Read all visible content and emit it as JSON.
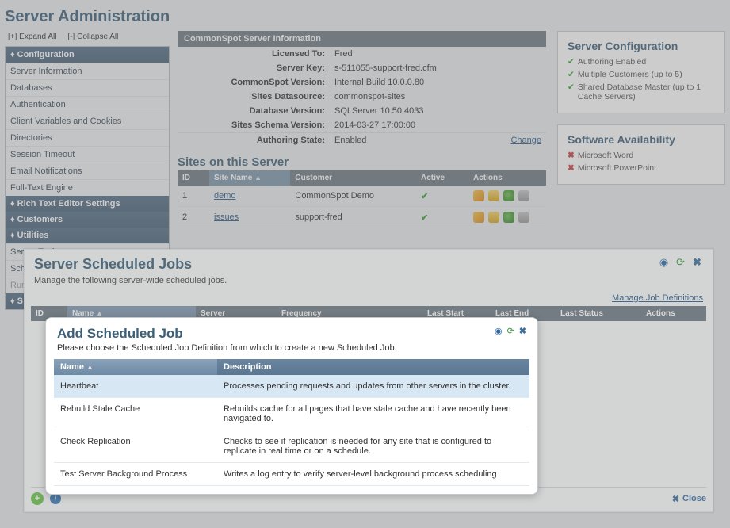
{
  "page_title": "Server Administration",
  "expand_all": "[+] Expand All",
  "collapse_all": "[-] Collapse All",
  "nav": {
    "configuration": {
      "header": "Configuration",
      "items": [
        "Server Information",
        "Databases",
        "Authentication",
        "Client Variables and Cookies",
        "Directories",
        "Session Timeout",
        "Email Notifications",
        "Full-Text Engine"
      ]
    },
    "rte": {
      "header": "Rich Text Editor Settings"
    },
    "customers": {
      "header": "Customers"
    },
    "utilities": {
      "header": "Utilities",
      "items": [
        "Server Tools",
        "Scheduled Jobs"
      ],
      "items_cut": [
        "Run"
      ]
    },
    "last_header_cut": "S"
  },
  "info_panel": {
    "title": "CommonSpot Server Information",
    "rows": [
      {
        "k": "Licensed To:",
        "v": "Fred"
      },
      {
        "k": "Server Key:",
        "v": "s-511055-support-fred.cfm"
      },
      {
        "k": "CommonSpot Version:",
        "v": "Internal Build 10.0.0.80"
      },
      {
        "k": "Sites Datasource:",
        "v": "commonspot-sites"
      },
      {
        "k": "Database Version:",
        "v": "SQLServer 10.50.4033"
      },
      {
        "k": "Sites Schema Version:",
        "v": "2014-03-27 17:00:00"
      }
    ],
    "auth_row": {
      "k": "Authoring State:",
      "v": "Enabled",
      "link": "Change"
    }
  },
  "sites_section": {
    "heading": "Sites on this Server",
    "cols": {
      "id": "ID",
      "name": "Site Name",
      "customer": "Customer",
      "active": "Active",
      "actions": "Actions"
    },
    "rows": [
      {
        "id": "1",
        "name": "demo",
        "customer": "CommonSpot Demo"
      },
      {
        "id": "2",
        "name": "issues",
        "customer": "support-fred"
      }
    ]
  },
  "right": {
    "config": {
      "title": "Server Configuration",
      "items": [
        "Authoring Enabled",
        "Multiple Customers (up to 5)",
        "Shared Database Master (up to 1 Cache Servers)"
      ]
    },
    "avail": {
      "title": "Software Availability",
      "items": [
        "Microsoft Word",
        "Microsoft PowerPoint"
      ]
    }
  },
  "modal1": {
    "title": "Server Scheduled Jobs",
    "sub": "Manage the following server-wide scheduled jobs.",
    "mjd": "Manage Job Definitions",
    "cols": {
      "id": "ID",
      "name": "Name",
      "server": "Server",
      "freq": "Frequency",
      "lstart": "Last Start",
      "lend": "Last End",
      "lstat": "Last Status",
      "actions": "Actions"
    },
    "close": "Close"
  },
  "modal2": {
    "title": "Add Scheduled Job",
    "sub": "Please choose the Scheduled Job Definition from which to create a new Scheduled Job.",
    "cols": {
      "name": "Name",
      "desc": "Description"
    },
    "rows": [
      {
        "name": "Heartbeat",
        "desc": "Processes pending requests and updates from other servers in the cluster."
      },
      {
        "name": "Rebuild Stale Cache",
        "desc": "Rebuilds cache for all pages that have stale cache and have recently been navigated to."
      },
      {
        "name": "Check Replication",
        "desc": "Checks to see if replication is needed for any site that is configured to replicate in real time or on a schedule."
      },
      {
        "name": "Test Server Background Process",
        "desc": "Writes a log entry to verify server-level background process scheduling"
      }
    ]
  },
  "sort_arrow": "▲"
}
